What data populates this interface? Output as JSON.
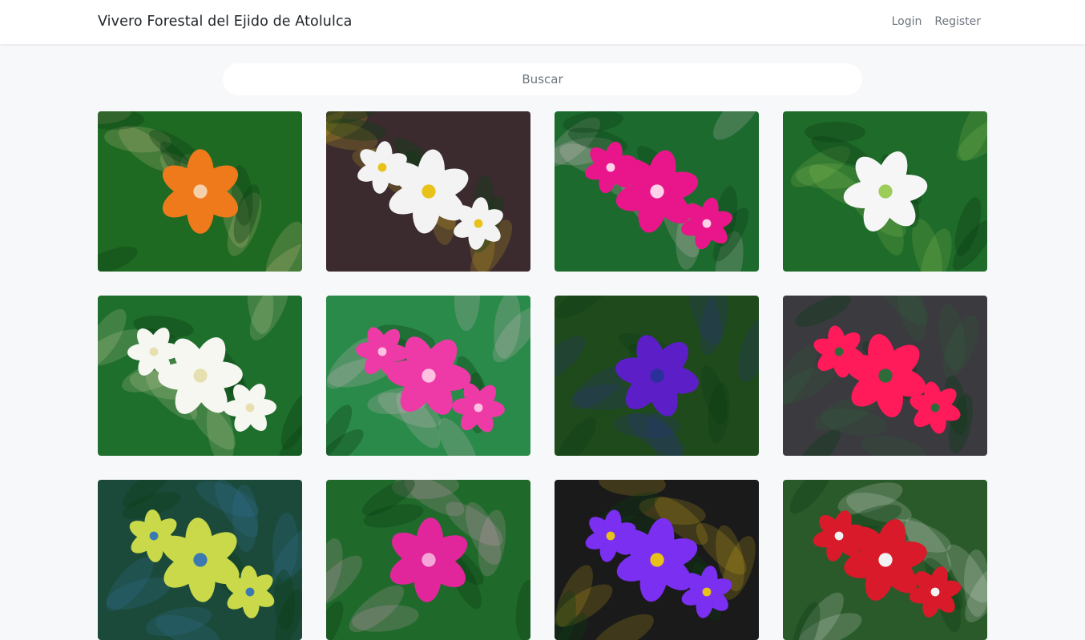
{
  "navbar": {
    "brand": "Vivero Forestal del Ejido de Atolulca",
    "links": [
      {
        "label": "Login"
      },
      {
        "label": "Register"
      }
    ]
  },
  "search": {
    "placeholder": "Buscar",
    "value": ""
  },
  "gallery": {
    "items": [
      {
        "flower": "orange-amaryllis",
        "colors": [
          "#1f6a22",
          "#ee7a1c",
          "#f6d0a8"
        ]
      },
      {
        "flower": "white-begonia",
        "colors": [
          "#3b2b2f",
          "#f3f3f3",
          "#e8c21a"
        ]
      },
      {
        "flower": "pink-impatiens",
        "colors": [
          "#1c6a2e",
          "#e8168a",
          "#ffd2ea"
        ]
      },
      {
        "flower": "white-pepper-flower",
        "colors": [
          "#1f6b2a",
          "#f6f6f6",
          "#9ccc5a"
        ]
      },
      {
        "flower": "peace-lily",
        "colors": [
          "#1e6e2c",
          "#f7f7f2",
          "#e6e0b0"
        ]
      },
      {
        "flower": "pink-dahlias",
        "colors": [
          "#2a8a4a",
          "#ee3aa6",
          "#ffc0e2"
        ]
      },
      {
        "flower": "purple-delphinium",
        "colors": [
          "#1f4a1c",
          "#5b1ec7",
          "#2a2f9a"
        ]
      },
      {
        "flower": "red-mandevilla",
        "colors": [
          "#3a3a3f",
          "#ff1a5a",
          "#2d6b3a"
        ]
      },
      {
        "flower": "variegated-foliage",
        "colors": [
          "#1b4a3a",
          "#c9d94a",
          "#3a7ab0"
        ]
      },
      {
        "flower": "magenta-daisies",
        "colors": [
          "#1f6a2a",
          "#e0269a",
          "#f5a5d8"
        ]
      },
      {
        "flower": "purple-balloon-flower",
        "colors": [
          "#1a1a1a",
          "#7b2ff0",
          "#e8c21a"
        ]
      },
      {
        "flower": "red-fuchsia",
        "colors": [
          "#2a5a2a",
          "#d81a2a",
          "#f2f2f2"
        ]
      }
    ]
  }
}
